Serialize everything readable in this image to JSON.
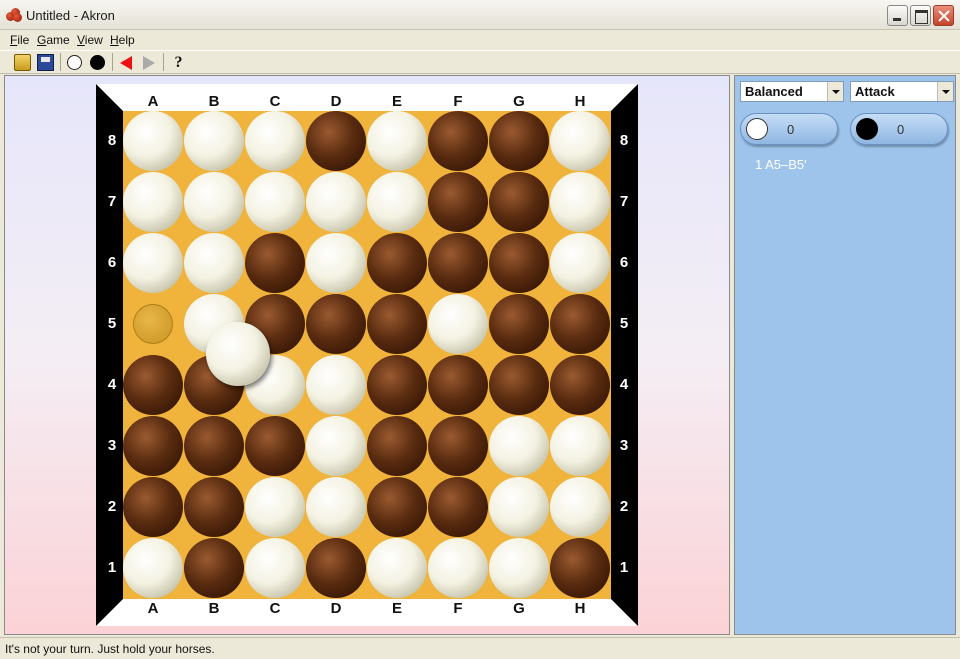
{
  "window": {
    "title": "Untitled - Akron"
  },
  "menu": [
    "File",
    "Game",
    "View",
    "Help"
  ],
  "toolbar": {
    "icons": [
      "open-folder-icon",
      "save-disk-icon",
      "white-stone-icon",
      "black-stone-icon",
      "back-arrow-icon",
      "forward-arrow-icon",
      "help-question-icon"
    ],
    "help_glyph": "?"
  },
  "board": {
    "columns": [
      "A",
      "B",
      "C",
      "D",
      "E",
      "F",
      "G",
      "H"
    ],
    "rows": [
      "8",
      "7",
      "6",
      "5",
      "4",
      "3",
      "2",
      "1"
    ],
    "cells": [
      [
        "w",
        "w",
        "w",
        "b",
        "w",
        "b",
        "b",
        "w"
      ],
      [
        "w",
        "w",
        "w",
        "w",
        "w",
        "b",
        "b",
        "w"
      ],
      [
        "w",
        "w",
        "b",
        "w",
        "b",
        "b",
        "b",
        "w"
      ],
      [
        "ghost",
        "w",
        "b",
        "b",
        "b",
        "w",
        "b",
        "b"
      ],
      [
        "b",
        "b",
        "w",
        "w",
        "b",
        "b",
        "b",
        "b"
      ],
      [
        "b",
        "b",
        "b",
        "w",
        "b",
        "b",
        "w",
        "w"
      ],
      [
        "b",
        "b",
        "w",
        "w",
        "b",
        "b",
        "w",
        "w"
      ],
      [
        "w",
        "b",
        "w",
        "b",
        "w",
        "w",
        "w",
        "b"
      ]
    ],
    "dragging_stone": "white",
    "colors": {
      "board": "#f0b33c",
      "frame": "#000000",
      "frame_edge": "#ffffff"
    }
  },
  "panel": {
    "white_player": "Balanced",
    "black_player": "Attack",
    "white_score": "0",
    "black_score": "0",
    "moves": [
      "1 A5–B5'"
    ],
    "background": "#9ec4ec"
  },
  "status": "It's not your turn. Just hold your horses."
}
